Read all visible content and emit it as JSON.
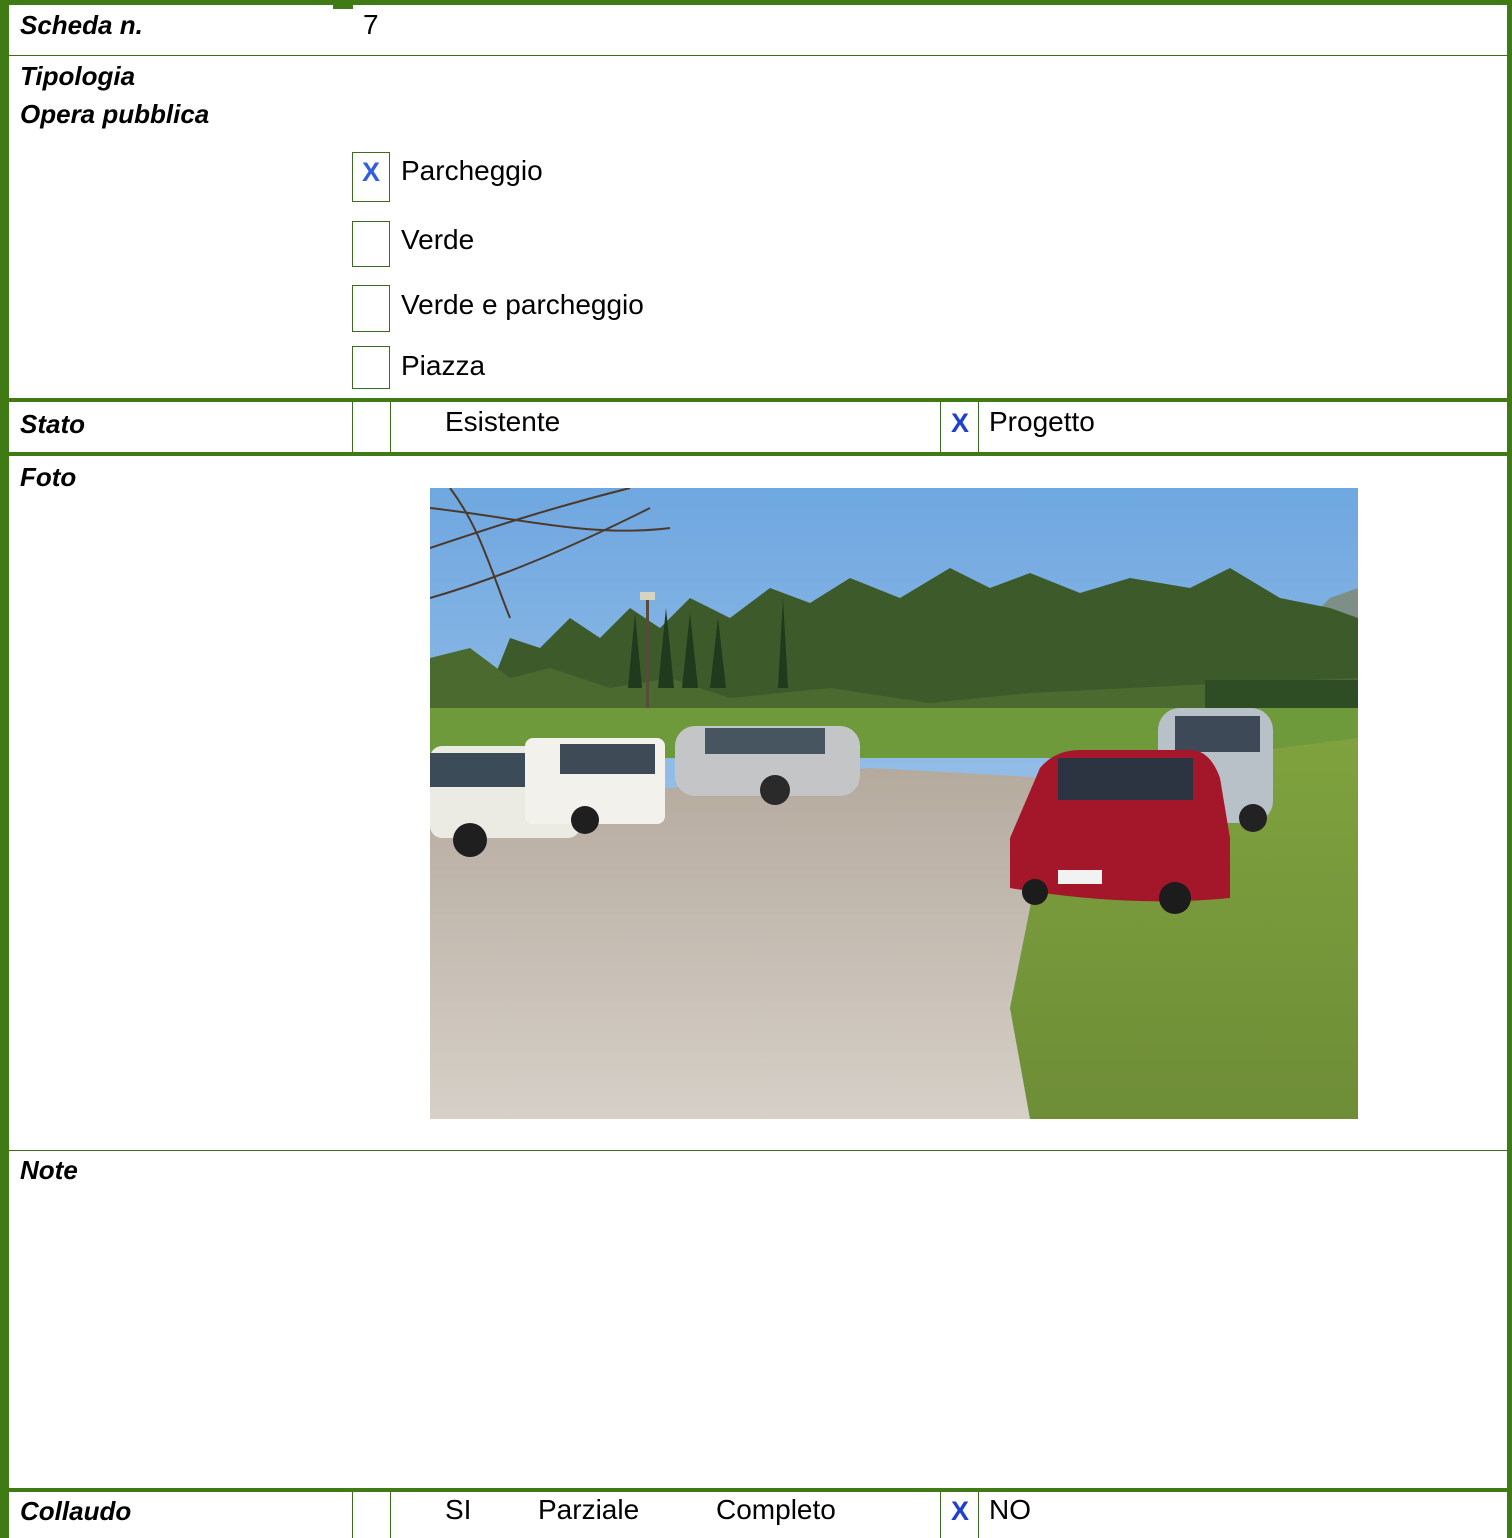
{
  "scheda": {
    "label": "Scheda n.",
    "value": "7"
  },
  "tipologia": {
    "label": "Tipologia",
    "sublabel": "Opera pubblica",
    "options": [
      {
        "label": "Parcheggio",
        "checked": true,
        "mark": "X"
      },
      {
        "label": "Verde",
        "checked": false,
        "mark": ""
      },
      {
        "label": "Verde e parcheggio",
        "checked": false,
        "mark": ""
      },
      {
        "label": "Piazza",
        "checked": false,
        "mark": ""
      }
    ]
  },
  "stato": {
    "label": "Stato",
    "esistente": {
      "label": "Esistente",
      "mark": ""
    },
    "progetto": {
      "label": "Progetto",
      "mark": "X"
    }
  },
  "foto": {
    "label": "Foto"
  },
  "note": {
    "label": "Note"
  },
  "collaudo": {
    "label": "Collaudo",
    "si": "SI",
    "parziale": "Parziale",
    "completo": "Completo",
    "si_mark": "",
    "no": {
      "label": "NO",
      "mark": "X"
    }
  },
  "colors": {
    "border": "#3f7a15",
    "check": "#2f5fe0"
  }
}
